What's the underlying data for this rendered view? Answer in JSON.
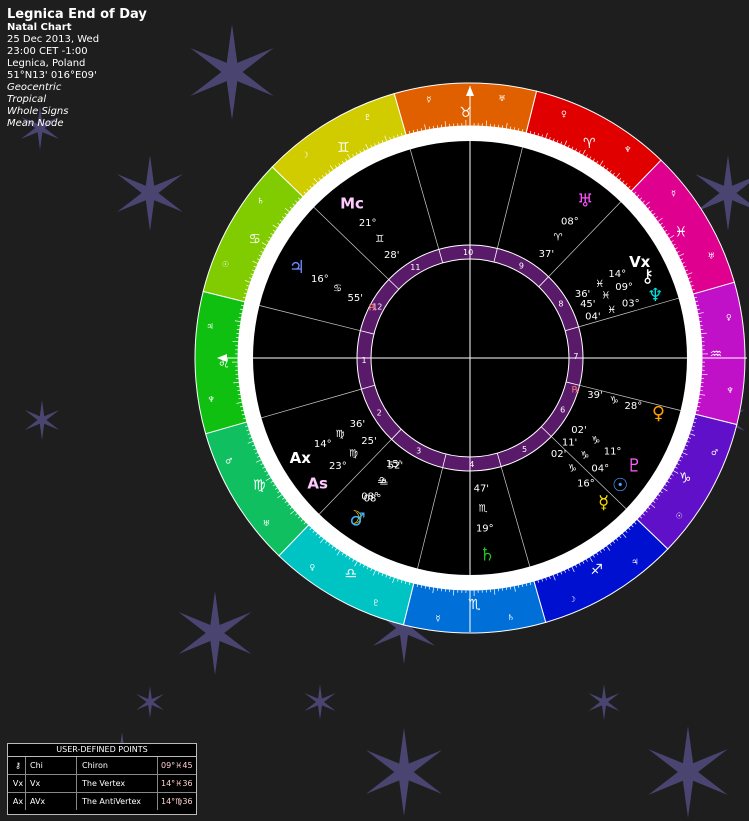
{
  "header": {
    "title": "Legnica End of Day",
    "subtitle": "Natal Chart",
    "date": "25 Dec 2013, Wed",
    "time": "23:00  CET -1:00",
    "place": "Legnica, Poland",
    "coords": "51°N13' 016°E09'",
    "options": [
      "Geocentric",
      "Tropical",
      "Whole Signs",
      "Mean Node"
    ]
  },
  "chart": {
    "asc_longitude": 134,
    "signs": [
      {
        "glyph": "♈",
        "color": "#e00000"
      },
      {
        "glyph": "♉",
        "color": "#e06000"
      },
      {
        "glyph": "♊",
        "color": "#d0cc00"
      },
      {
        "glyph": "♋",
        "color": "#80cc00"
      },
      {
        "glyph": "♌",
        "color": "#10c010"
      },
      {
        "glyph": "♍",
        "color": "#10c060"
      },
      {
        "glyph": "♎",
        "color": "#00c4c4"
      },
      {
        "glyph": "♏",
        "color": "#0070d8"
      },
      {
        "glyph": "♐",
        "color": "#0010d0"
      },
      {
        "glyph": "♑",
        "color": "#6010c8"
      },
      {
        "glyph": "♒",
        "color": "#c010c8"
      },
      {
        "glyph": "♓",
        "color": "#e00090"
      }
    ],
    "houses": [
      "1",
      "2",
      "3",
      "4",
      "5",
      "6",
      "7",
      "8",
      "9",
      "10",
      "11",
      "12"
    ],
    "mc": {
      "glyph": "Mc",
      "deg": "21°",
      "sign": "♊",
      "min": "28'"
    },
    "planets": [
      {
        "name": "Jupiter",
        "glyph": "♃",
        "color": "#6f8cff",
        "deg": "16°",
        "sign": "♋",
        "min": "55'",
        "retro": "℞",
        "lon": 106
      },
      {
        "name": "Uranus",
        "glyph": "♅",
        "color": "#ff50ff",
        "deg": "08°",
        "sign": "♈",
        "min": "37'",
        "retro": "",
        "lon": 8
      },
      {
        "name": "Vertex",
        "glyph": "Vx",
        "color": "#ffffff",
        "deg": "14°",
        "sign": "♓",
        "min": "36'",
        "retro": "",
        "lon": 344
      },
      {
        "name": "Chiron",
        "glyph": "⚷",
        "color": "#ffffff",
        "deg": "09°",
        "sign": "♓",
        "min": "45'",
        "retro": "",
        "lon": 339
      },
      {
        "name": "Neptune",
        "glyph": "♆",
        "color": "#00e0e0",
        "deg": "03°",
        "sign": "♓",
        "min": "04'",
        "retro": "",
        "lon": 333
      },
      {
        "name": "AntiVertex",
        "glyph": "Ax",
        "color": "#ffffff",
        "deg": "14°",
        "sign": "♍",
        "min": "36'",
        "retro": "",
        "lon": 164
      },
      {
        "name": "Ascendant",
        "glyph": "As",
        "color": "#ffc8ff",
        "deg": "23°",
        "sign": "♍",
        "min": "25'",
        "retro": "",
        "lon": 173
      },
      {
        "name": "Moon",
        "glyph": "☽",
        "color": "#ffe000",
        "deg": "08°",
        "sign": "♎",
        "min": "15'",
        "retro": "",
        "lon": 188
      },
      {
        "name": "Mars",
        "glyph": "♂",
        "color": "#40b0ff",
        "deg": "08°",
        "sign": "♎",
        "min": "52'",
        "retro": "",
        "lon": 189
      },
      {
        "name": "Saturn",
        "glyph": "♄",
        "color": "#20c020",
        "deg": "19°",
        "sign": "♏",
        "min": "47'",
        "retro": "",
        "lon": 229
      },
      {
        "name": "Sun",
        "glyph": "☉",
        "color": "#4fa0ff",
        "deg": "04°",
        "sign": "♑",
        "min": "11'",
        "retro": "",
        "lon": 274
      },
      {
        "name": "Mercury",
        "glyph": "☿",
        "color": "#ffe000",
        "deg": "16°",
        "sign": "♑",
        "min": "02'",
        "retro": "",
        "lon": 267
      },
      {
        "name": "Pluto",
        "glyph": "♇",
        "color": "#ff60ff",
        "deg": "11°",
        "sign": "♑",
        "min": "02'",
        "retro": "",
        "lon": 281
      },
      {
        "name": "Venus",
        "glyph": "♀",
        "color": "#ffa000",
        "deg": "28°",
        "sign": "♑",
        "min": "39'",
        "retro": "℞",
        "lon": 298
      }
    ]
  },
  "user_points": {
    "title": "USER-DEFINED POINTS",
    "rows": [
      {
        "glyph": "⚷",
        "abbr": "Chi",
        "name": "Chiron",
        "pos": "09°♓45"
      },
      {
        "glyph": "Vx",
        "abbr": "Vx",
        "name": "The Vertex",
        "pos": "14°♓36"
      },
      {
        "glyph": "Ax",
        "abbr": "AVx",
        "name": "The AntiVertex",
        "pos": "14°♍36"
      }
    ]
  }
}
